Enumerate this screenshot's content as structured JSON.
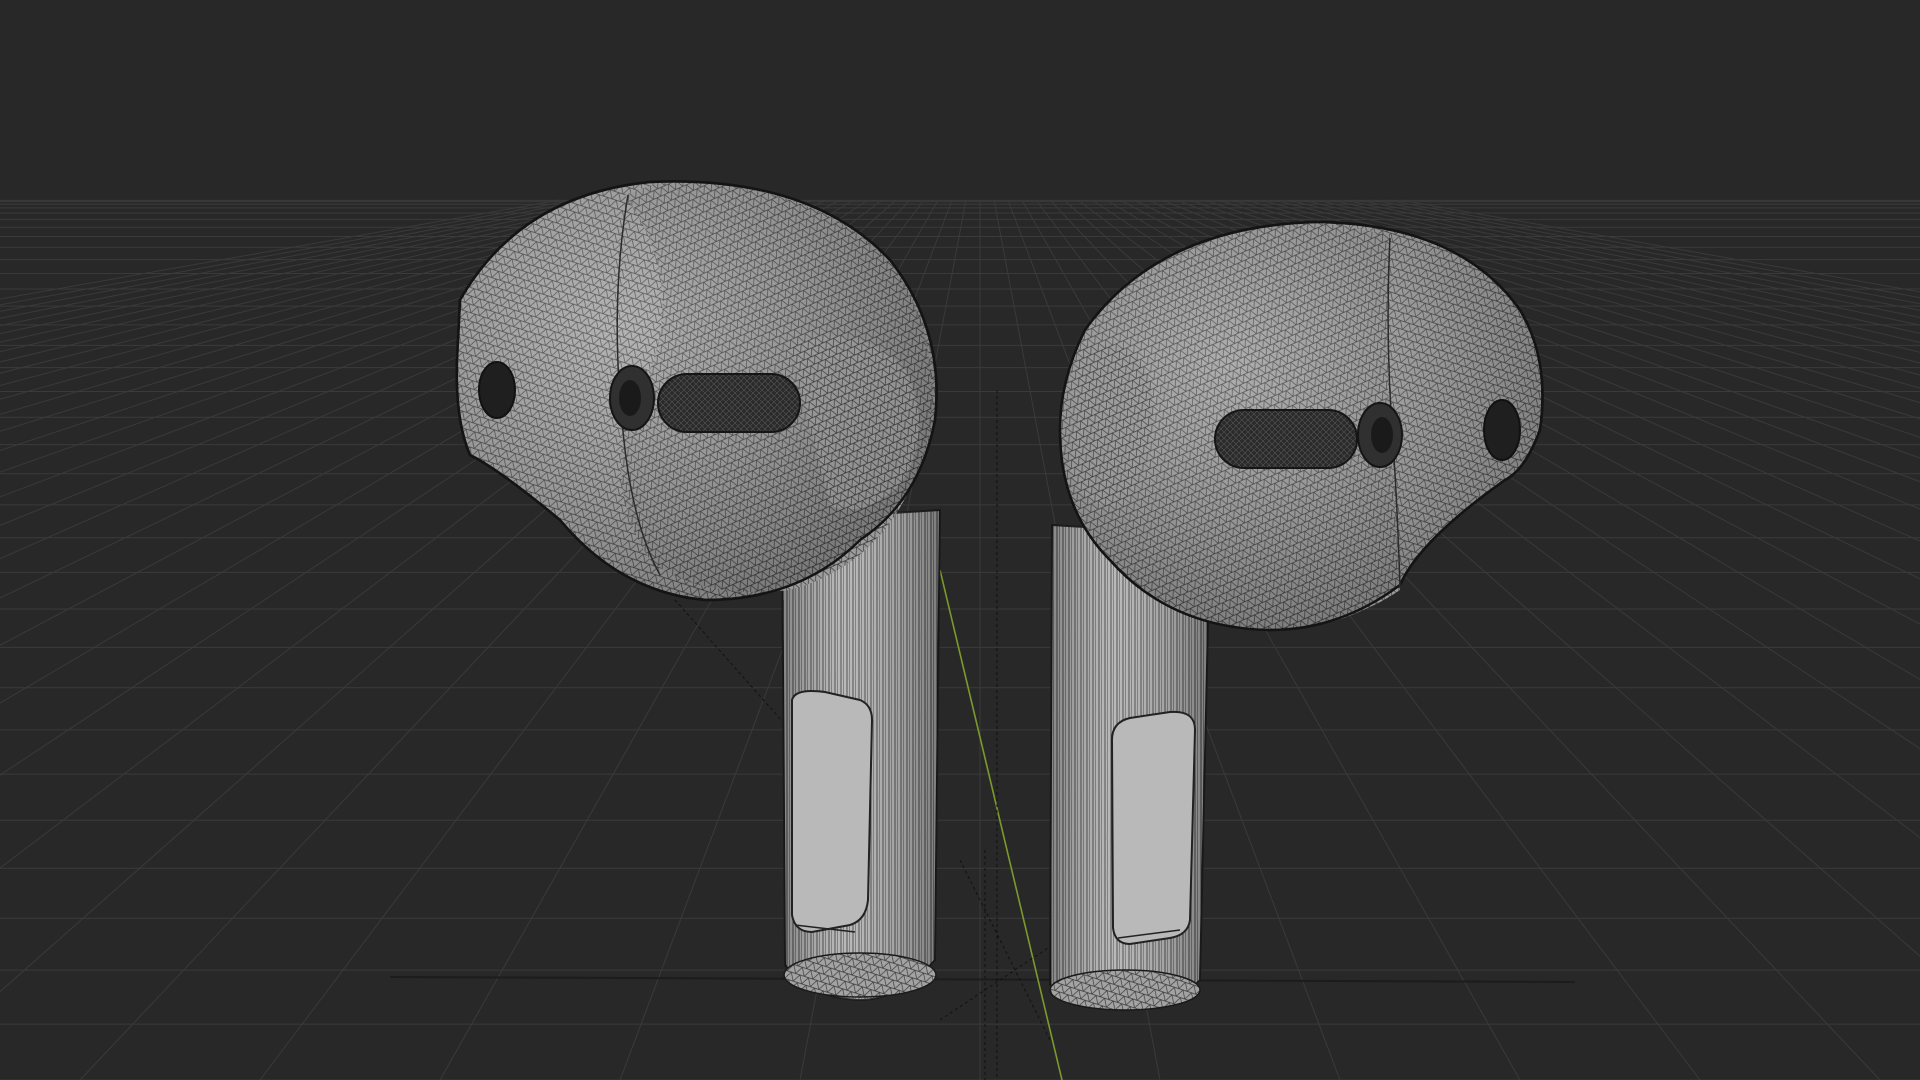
{
  "viewport": {
    "background": "#282828",
    "grid_color": "#3a3a3a",
    "grid_major_color": "#444444",
    "axis_y_color": "#7a9a2a",
    "axis_x_color": "#222222",
    "model_fill": "#9a9a9a",
    "model_fill_light": "#b4b4b4",
    "wire_color": "#2a2a2a",
    "mesh_opening_color": "#202020",
    "panel_fill": "#b8b8b8"
  },
  "scene": {
    "objects": [
      {
        "name": "earbud-left"
      },
      {
        "name": "earbud-right"
      }
    ]
  }
}
